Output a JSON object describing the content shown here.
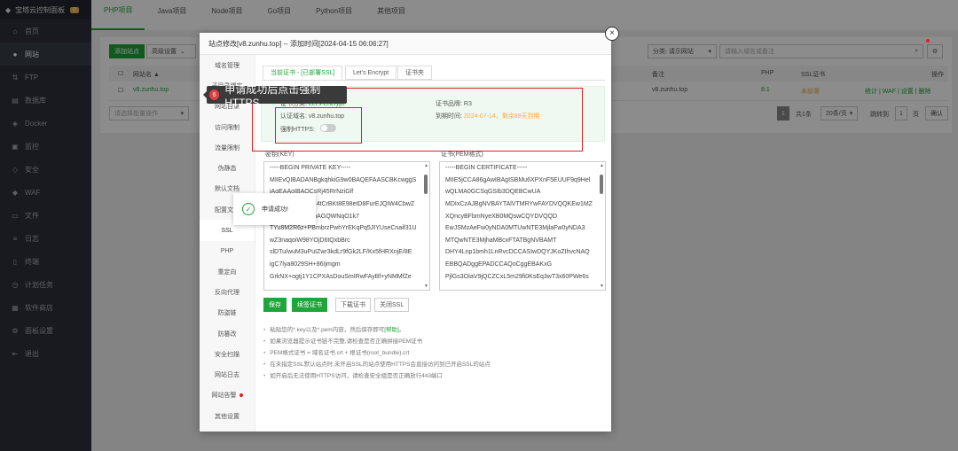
{
  "sidebar": {
    "brand": "宝塔云控制面板",
    "brand_count": "0",
    "items": [
      {
        "label": "首页",
        "icon": "home-icon"
      },
      {
        "label": "网站",
        "icon": "globe-icon"
      },
      {
        "label": "FTP",
        "icon": "ftp-icon"
      },
      {
        "label": "数据库",
        "icon": "database-icon"
      },
      {
        "label": "Docker",
        "icon": "docker-icon"
      },
      {
        "label": "监控",
        "icon": "monitor-icon"
      },
      {
        "label": "安全",
        "icon": "shield-icon"
      },
      {
        "label": "WAF",
        "icon": "waf-icon"
      },
      {
        "label": "文件",
        "icon": "folder-icon"
      },
      {
        "label": "日志",
        "icon": "log-icon"
      },
      {
        "label": "终端",
        "icon": "terminal-icon"
      },
      {
        "label": "计划任务",
        "icon": "clock-icon"
      },
      {
        "label": "软件商店",
        "icon": "store-icon"
      },
      {
        "label": "面板设置",
        "icon": "gear-icon"
      },
      {
        "label": "退出",
        "icon": "logout-icon"
      }
    ]
  },
  "top_tabs": [
    "PHP项目",
    "Java项目",
    "Node项目",
    "Go项目",
    "Python项目",
    "其他项目"
  ],
  "toolbar": {
    "add_site": "添加站点",
    "advanced": "高级设置",
    "category": "分类: 请示网站",
    "search_placeholder": "请输入域名或备注"
  },
  "table": {
    "headers": {
      "name": "网站名 ▲",
      "note": "备注",
      "php": "PHP",
      "ssl": "SSL证书",
      "action": "操作"
    },
    "row": {
      "name": "v8.zunhu.top",
      "note": "v8.zunhu.top",
      "php": "8.1",
      "ssl": "未部署",
      "actions": "统计 | WAF | 设置 | 删除"
    },
    "batch_placeholder": "请选择批量操作",
    "pager": {
      "current": "1",
      "total": "共1条",
      "per_page": "20条/页",
      "jump": "跳转到",
      "page_input": "1",
      "page": "页",
      "confirm": "确认"
    }
  },
  "modal": {
    "title": "站点修改[v8.zunhu.top] -- 添加时间[2024-04-15 06:06:27]",
    "nav": [
      "域名管理",
      "子目录绑定",
      "网站目录",
      "访问限制",
      "流量限制",
      "伪静态",
      "默认文档",
      "配置文件",
      "SSL",
      "PHP",
      "重定向",
      "反向代理",
      "防盗链",
      "防篡改",
      "安全扫描",
      "网站日志",
      "网站告警",
      "其他设置"
    ],
    "tabs": [
      "当前证书 - [已部署SSL]",
      "Let's Encrypt",
      "证书夹"
    ],
    "cert": {
      "type_label": "证书分类:",
      "type_value": "Let's Encrypt",
      "brand_label": "证书品牌:",
      "brand_value": "R3",
      "domain_label": "认证域名:",
      "domain_value": "v8.zunhu.top",
      "expire_label": "到期时间:",
      "expire_value": "2024-07-14，剩余89天到期",
      "https_label": "强制HTTPS:"
    },
    "key_label": "密钥(KEY)",
    "pem_label": "证书(PEM格式)",
    "key_lines": [
      "-----BEGIN PRIVATE KEY-----",
      "MIIEvQIBADANBgkqhkiG9w0BAQEFAASCBKcwggS",
      "jAgEAAoIBAQCsRj45RrNziGlf",
      "Y0AmQs5+ZmfX4tCrBKt8E98etD8FurEJQIW4CbwZ",
      "yC+iKbnJsEJv1pAGQWNqO1k7",
      "TYu8M2R6z+PBmbrzPwhYrEKqPq5JIYUseCnaif31U",
      "wZ3naqoiW98YOjD6tQxbBrc",
      "slDTu/wuM3uPuIZwr3kdLr9fGk2LF/Kx5fHRXnjE/8E",
      "igC7lya8029SH+86Ijmgm",
      "GrkNX+ogtj1Y1CPXAsDouSmIRwFAyBf+yNMMfZe"
    ],
    "pem_lines": [
      "-----BEGIN CERTIFICATE-----",
      "MIIE5jCCA86gAwIBAgISBMu6XPXnF5EUUF9q9Hel",
      "wQLMA0GCSqGSIb3DQEBCwUA",
      "MDIxCzAJBgNVBAYTAlVTMRYwFAYDVQQKEw1MZ",
      "XQncyBFbmNyeXB0MQswCQYDVQQD",
      "EwJSMzAeFw0yNDA0MTUwNTE3MjlaFw0yNDA3",
      "MTQwNTE3MjhaMBcxFTATBgNVBAMT",
      "DHY4Lnp1bmh1LnRvcDCCASIwDQYJKoZIhvcNAQ",
      "EBBQADggEPADCCAQoCggEBAKxG",
      "PjlGs3OIaV9jQCZCxL5m29fi0KsEq3wT3x60PWe6s"
    ],
    "buttons": {
      "save": "保存",
      "renew": "续签证书",
      "download": "下载证书",
      "close_ssl": "关闭SSL"
    },
    "tips": [
      {
        "text": "粘贴您的*.key以及*.pem内容，然后保存即可",
        "link": "[帮助]",
        "end": "。"
      },
      {
        "text": "如果浏览器提示证书链不完整,请检查是否正确拼接PEM证书",
        "link": "",
        "end": ""
      },
      {
        "text": "PEM格式证书 = 域名证书.crt + 根证书(root_bundle).crt",
        "link": "",
        "end": ""
      },
      {
        "text": "在未指定SSL默认站点时,未开启SSL的站点使用HTTPS会直接访问到已开启SSL的站点",
        "link": "",
        "end": ""
      },
      {
        "text": "如开启后无法使用HTTPS访问，请检查安全组是否正确放行443端口",
        "link": "",
        "end": ""
      }
    ]
  },
  "callout": {
    "number": "6",
    "text": "申请成功后点击强制HTTPS"
  },
  "toast": {
    "text": "申请成功!"
  },
  "colors": {
    "accent": "#20a53a",
    "highlight": "#e02020"
  }
}
